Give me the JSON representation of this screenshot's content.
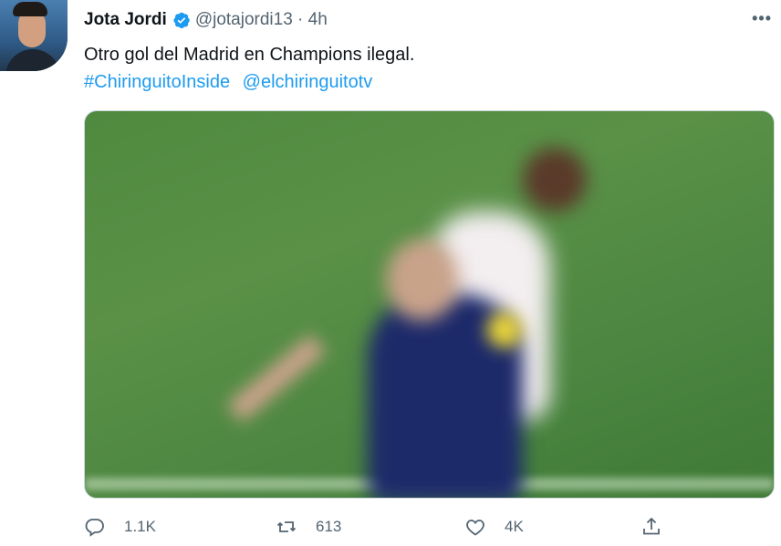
{
  "tweet": {
    "author_name": "Jota Jordi",
    "handle_time": "@jotajordi13 · 4h",
    "text": "Otro gol del Madrid en Champions ilegal.",
    "hashtag": "#ChiringuitoInside",
    "mention": "@elchiringuitotv",
    "more_label": "•••"
  },
  "actions": {
    "reply_count": "1.1K",
    "retweet_count": "613",
    "like_count": "4K"
  },
  "colors": {
    "link": "#1d9bf0",
    "muted": "#536471",
    "verified": "#1d9bf0"
  }
}
